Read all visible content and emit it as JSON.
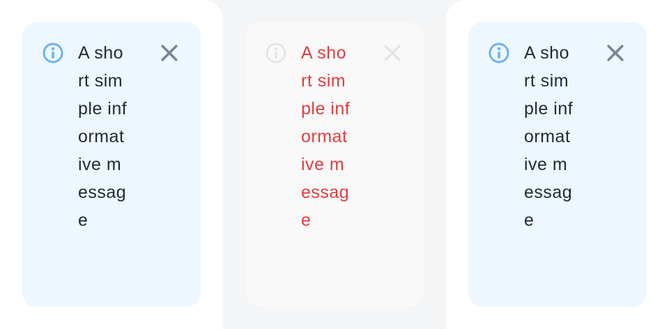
{
  "alert": {
    "message": "A short simple informative message",
    "icon": "info-icon",
    "close_icon": "close-icon",
    "accent_color": "#6db3f2",
    "background_color": "#eef6fe",
    "text_color": "#1f2937"
  },
  "variants": [
    "normal",
    "faded",
    "normal"
  ]
}
